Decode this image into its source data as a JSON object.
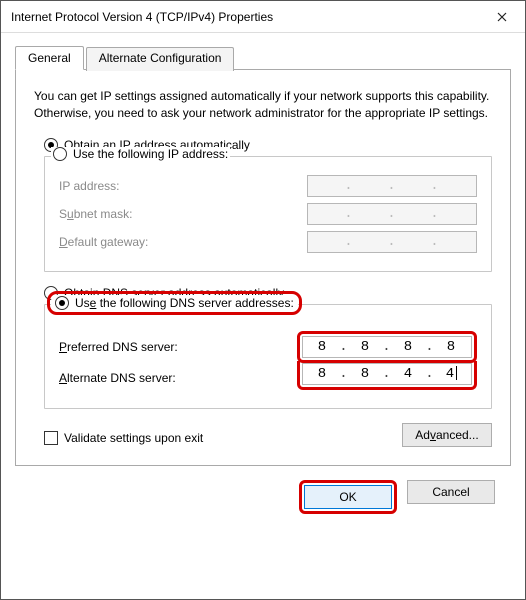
{
  "window": {
    "title": "Internet Protocol Version 4 (TCP/IPv4) Properties"
  },
  "tabs": {
    "general": "General",
    "alternate": "Alternate Configuration"
  },
  "description": "You can get IP settings assigned automatically if your network supports this capability. Otherwise, you need to ask your network administrator for the appropriate IP settings.",
  "ip": {
    "auto_prefix": "O",
    "auto_rest": "btain an IP address automatically",
    "manual_prefix": "Use the following IP address:",
    "label_ip_pre": "I",
    "label_ip_rest": "P address:",
    "label_subnet_pre": "S",
    "label_subnet_rest": "u",
    "label_subnet_rest2": "bnet mask:",
    "label_gw_pre": "D",
    "label_gw_rest": "efault gateway:"
  },
  "dns": {
    "auto_pre": "O",
    "auto_uline": "b",
    "auto_rest": "tain DNS server address automatically",
    "manual_pre": "Us",
    "manual_uline": "e",
    "manual_rest": " the following DNS server addresses:",
    "pref_pre": "P",
    "pref_rest": "referred DNS server:",
    "alt_pre": "A",
    "alt_rest": "lternate DNS server:",
    "pref_oct1": "8",
    "pref_oct2": "8",
    "pref_oct3": "8",
    "pref_oct4": "8",
    "alt_oct1": "8",
    "alt_oct2": "8",
    "alt_oct3": "4",
    "alt_oct4": "4"
  },
  "validate_pre": "V",
  "validate_rest": "alidate settings upon exit",
  "buttons": {
    "advanced_pre": "Ad",
    "advanced_uline": "v",
    "advanced_rest": "anced...",
    "ok": "OK",
    "cancel": "Cancel"
  }
}
